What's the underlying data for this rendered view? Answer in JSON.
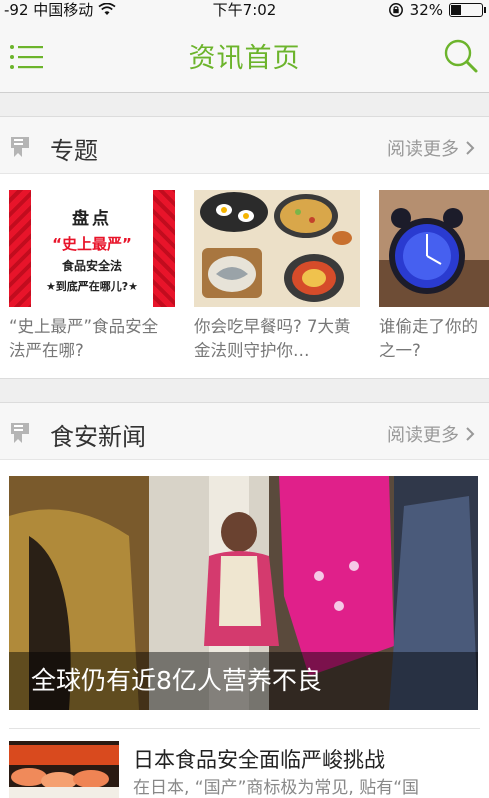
{
  "status_bar": {
    "signal": "-92",
    "carrier": "中国移动",
    "time": "下午7:02",
    "battery": "32%",
    "battery_level": 0.32
  },
  "navbar": {
    "title": "资讯首页",
    "menu_icon": "menu-list-icon",
    "search_icon": "search-icon"
  },
  "colors": {
    "accent": "#6cb42c",
    "muted": "#999999"
  },
  "topics": {
    "label": "专题",
    "more": "阅读更多",
    "cards": [
      {
        "image_lines": [
          "盘点",
          "“史上最严”",
          "食品安全法",
          "★到底严在哪儿?★"
        ],
        "caption": "“史上最严”食品安全法严在哪?"
      },
      {
        "caption": "你会吃早餐吗? 7大黄金法则守护你…"
      },
      {
        "caption": "谁偷走了你的之一?"
      }
    ]
  },
  "news": {
    "label": "食安新闻",
    "more": "阅读更多",
    "hero_caption": "全球仍有近8亿人营养不良",
    "items": [
      {
        "title": "日本食品安全面临严峻挑战",
        "desc": "在日本, “国产”商标极为常见, 贴有“国"
      }
    ]
  }
}
